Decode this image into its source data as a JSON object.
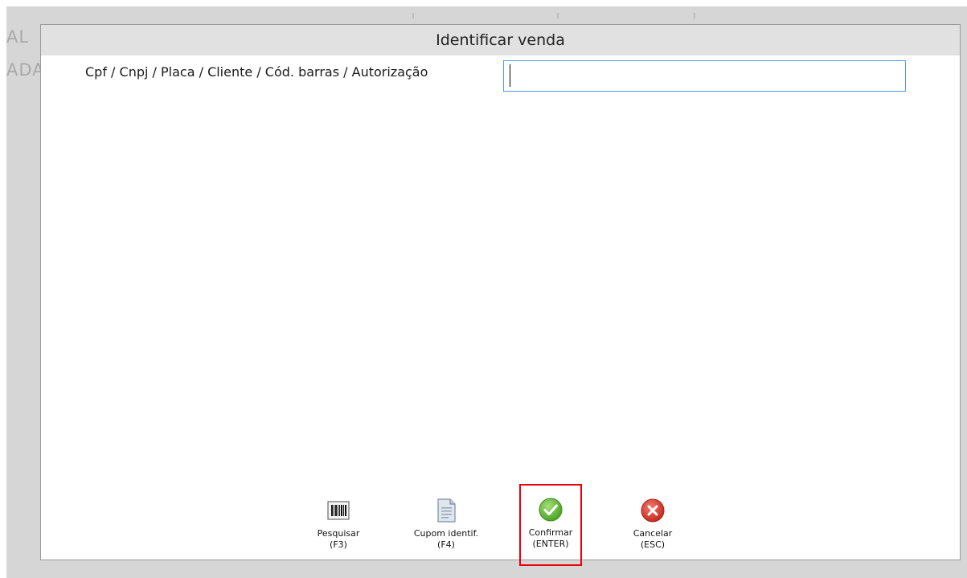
{
  "background": {
    "text_line_1": "AL",
    "text_line_2": "ADA"
  },
  "dialog": {
    "title": "Identificar venda",
    "field": {
      "label": "Cpf / Cnpj / Placa / Cliente / Cód. barras / Autorização",
      "value": ""
    },
    "buttons": [
      {
        "icon": "barcode-icon",
        "label_line1": "Pesquisar",
        "label_line2": "(F3)"
      },
      {
        "icon": "document-icon",
        "label_line1": "Cupom identif.",
        "label_line2": "(F4)"
      },
      {
        "icon": "check-circle-icon",
        "label_line1": "Confirmar",
        "label_line2": "(ENTER)",
        "highlighted": true
      },
      {
        "icon": "cancel-circle-icon",
        "label_line1": "Cancelar",
        "label_line2": "(ESC)"
      }
    ]
  },
  "colors": {
    "backdrop": "#d6d6d6",
    "titlebar": "#e1e1e1",
    "input_border": "#569de5",
    "highlight_border": "#e8000b",
    "confirm_green": "#5cb531",
    "cancel_red": "#d9342b"
  }
}
